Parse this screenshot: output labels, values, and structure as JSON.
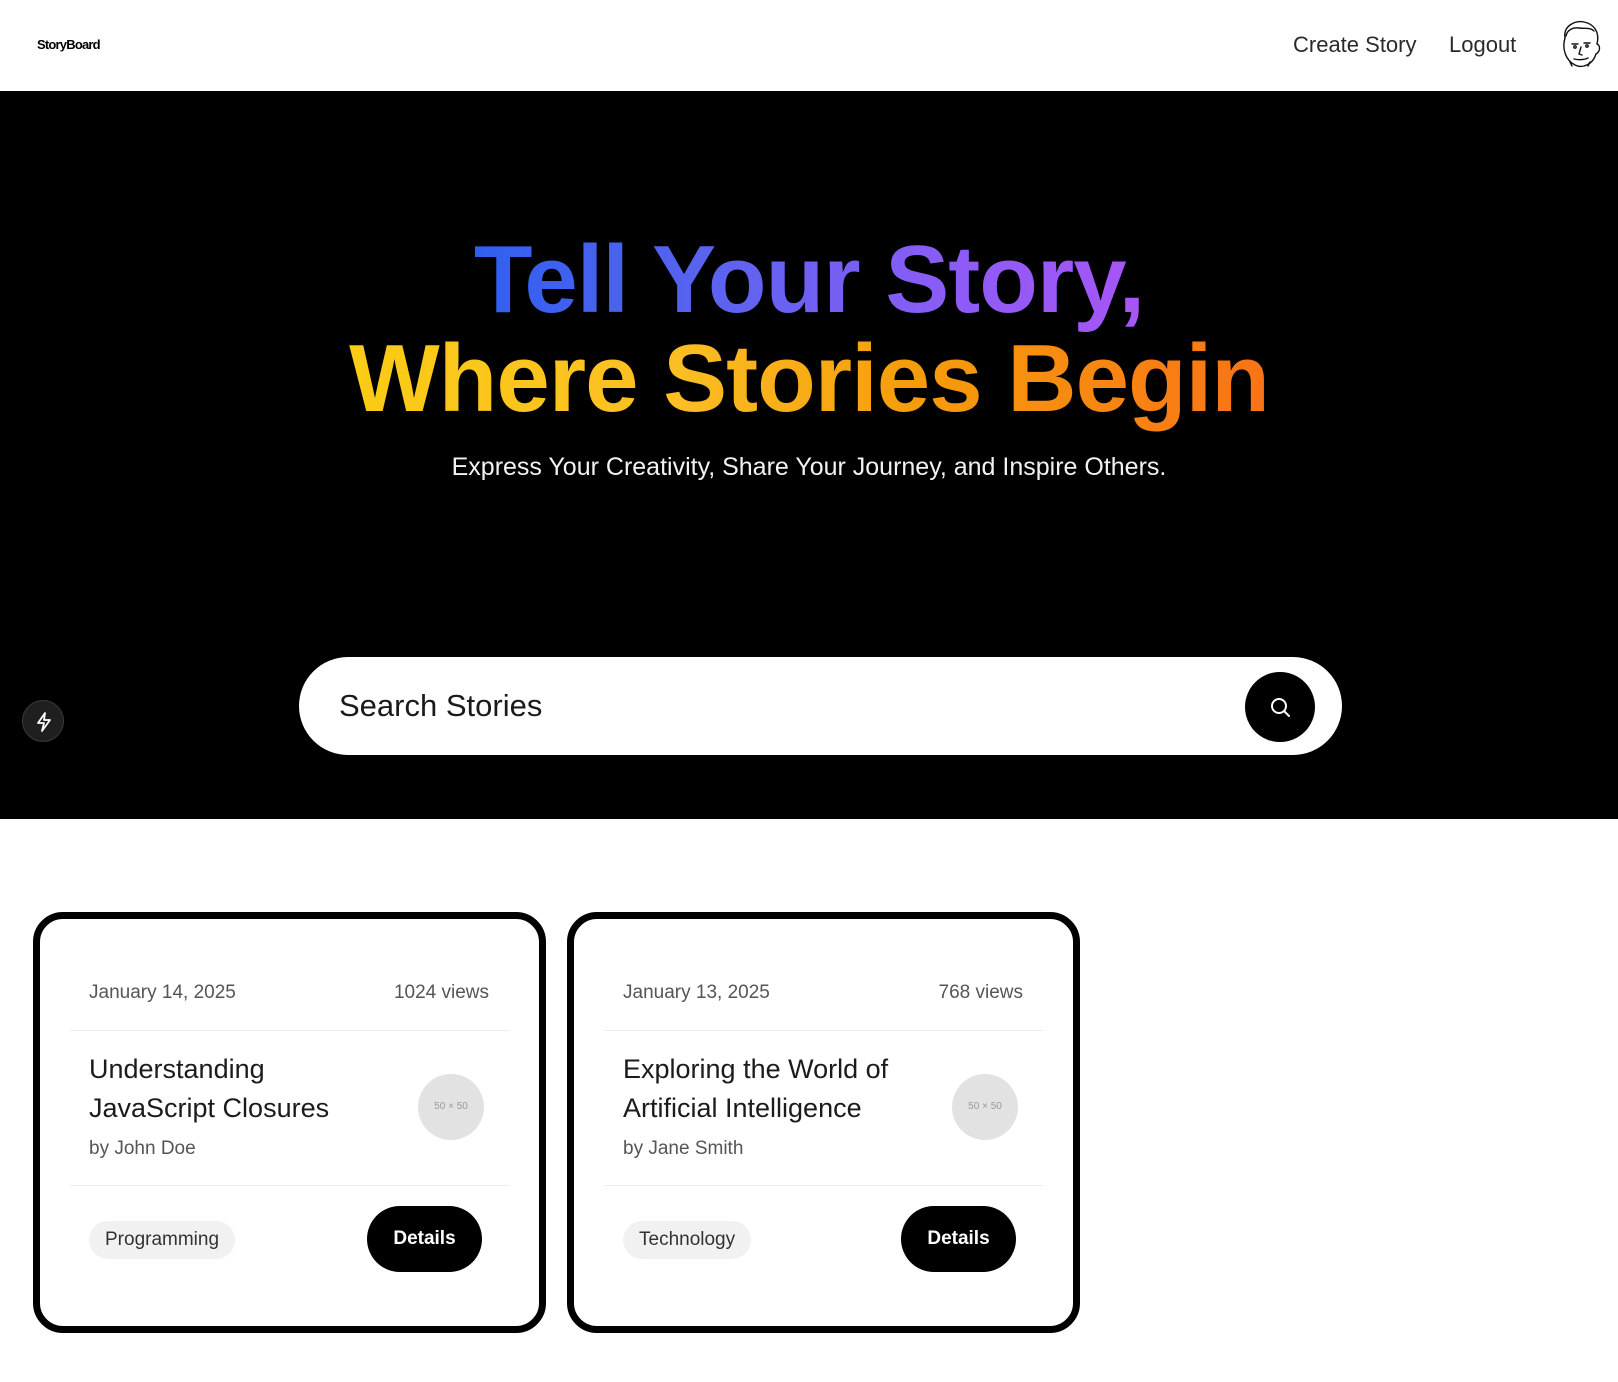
{
  "header": {
    "logo": "StoryBoard",
    "nav": {
      "create_story": "Create Story",
      "logout": "Logout"
    }
  },
  "hero": {
    "title_line1": "Tell Your Story,",
    "title_line2": "Where Stories Begin",
    "subtitle": "Express Your Creativity, Share Your Journey, and Inspire Others.",
    "search": {
      "placeholder": "Search Stories",
      "value": ""
    }
  },
  "cards": [
    {
      "date": "January 14, 2025",
      "views": "1024 views",
      "title": "Understanding JavaScript Closures",
      "author": "by John Doe",
      "thumbnail": "50 × 50",
      "tag": "Programming",
      "details_label": "Details"
    },
    {
      "date": "January 13, 2025",
      "views": "768 views",
      "title": "Exploring the World of Artificial Intelligence",
      "author": "by Jane Smith",
      "thumbnail": "50 × 50",
      "tag": "Technology",
      "details_label": "Details"
    }
  ],
  "icons": {
    "search": "search-icon",
    "bolt": "bolt-icon",
    "avatar": "avatar-icon"
  },
  "colors": {
    "hero_background": "#000000",
    "title_gradient_blue": [
      "#2f5ff0",
      "#a855f7"
    ],
    "title_gradient_orange": [
      "#facc15",
      "#f97316"
    ],
    "button_background": "#000000",
    "card_border": "#000000"
  }
}
